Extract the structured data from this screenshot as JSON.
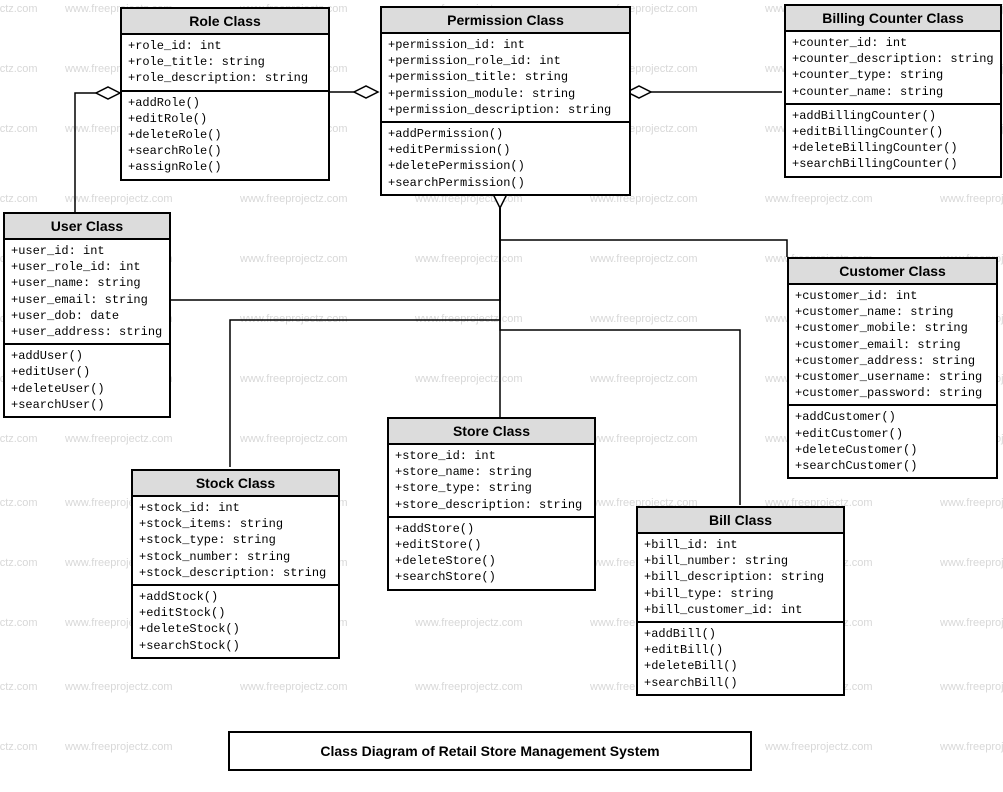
{
  "title": "Class Diagram of Retail Store Management System",
  "watermark_text": "www.freeprojectz.com",
  "classes": {
    "role": {
      "name": "Role Class",
      "attrs": [
        "+role_id: int",
        "+role_title: string",
        "+role_description: string"
      ],
      "ops": [
        "+addRole()",
        "+editRole()",
        "+deleteRole()",
        "+searchRole()",
        "+assignRole()"
      ]
    },
    "permission": {
      "name": "Permission Class",
      "attrs": [
        "+permission_id: int",
        "+permission_role_id: int",
        "+permission_title: string",
        "+permission_module: string",
        "+permission_description: string"
      ],
      "ops": [
        "+addPermission()",
        "+editPermission()",
        "+deletePermission()",
        "+searchPermission()"
      ]
    },
    "billing": {
      "name": "Billing Counter Class",
      "attrs": [
        "+counter_id: int",
        "+counter_description: string",
        "+counter_type: string",
        "+counter_name: string"
      ],
      "ops": [
        "+addBillingCounter()",
        "+editBillingCounter()",
        "+deleteBillingCounter()",
        "+searchBillingCounter()"
      ]
    },
    "user": {
      "name": "User Class",
      "attrs": [
        "+user_id: int",
        "+user_role_id: int",
        "+user_name: string",
        "+user_email: string",
        "+user_dob: date",
        "+user_address: string"
      ],
      "ops": [
        "+addUser()",
        "+editUser()",
        "+deleteUser()",
        "+searchUser()"
      ]
    },
    "customer": {
      "name": "Customer Class",
      "attrs": [
        "+customer_id: int",
        "+customer_name: string",
        "+customer_mobile: string",
        "+customer_email: string",
        "+customer_address: string",
        "+customer_username: string",
        "+customer_password: string"
      ],
      "ops": [
        "+addCustomer()",
        "+editCustomer()",
        "+deleteCustomer()",
        "+searchCustomer()"
      ]
    },
    "stock": {
      "name": "Stock Class",
      "attrs": [
        "+stock_id: int",
        "+stock_items: string",
        "+stock_type: string",
        "+stock_number: string",
        "+stock_description: string"
      ],
      "ops": [
        "+addStock()",
        "+editStock()",
        "+deleteStock()",
        "+searchStock()"
      ]
    },
    "store": {
      "name": "Store Class",
      "attrs": [
        "+store_id: int",
        "+store_name: string",
        "+store_type: string",
        "+store_description: string"
      ],
      "ops": [
        "+addStore()",
        "+editStore()",
        "+deleteStore()",
        "+searchStore()"
      ]
    },
    "bill": {
      "name": "Bill Class",
      "attrs": [
        "+bill_id: int",
        "+bill_number: string",
        "+bill_description: string",
        "+bill_type: string",
        "+bill_customer_id: int"
      ],
      "ops": [
        "+addBill()",
        "+editBill()",
        "+deleteBill()",
        "+searchBill()"
      ]
    }
  }
}
